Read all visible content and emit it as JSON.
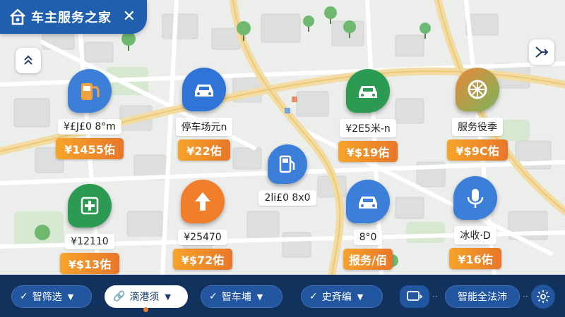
{
  "app": {
    "title": "车主服务之家",
    "close_glyph": "✕",
    "home_icon": "home-icon"
  },
  "controls": {
    "collapse_icon": "chevron-up-icon",
    "exit_icon": "exit-route-icon"
  },
  "pois": [
    {
      "id": "gas-station",
      "icon": "gas-station-icon",
      "color": "#3b7fd8",
      "label": "¥£J£0 8°m",
      "price": "¥1455佑"
    },
    {
      "id": "parking",
      "icon": "car-icon",
      "color": "#2f74d6",
      "label": "停车场元n",
      "price": "¥22佑"
    },
    {
      "id": "car-wash",
      "icon": "car-icon",
      "color": "#2c9a52",
      "label": "¥2E5米-n",
      "price": "¥$19佑"
    },
    {
      "id": "service-station",
      "icon": "compass-icon",
      "color": "#e8883a",
      "label": "服务役季",
      "price": "¥$9C佑"
    },
    {
      "id": "fuel-pump",
      "icon": "fuel-pump-icon",
      "color": "#3b7fd8",
      "label": "2li£0 8x0",
      "price": ""
    },
    {
      "id": "medical",
      "icon": "medical-cross-icon",
      "color": "#2c9a52",
      "label": "¥12110",
      "price": "¥$13佑"
    },
    {
      "id": "navigation",
      "icon": "arrow-up-icon",
      "color": "#f07e2b",
      "label": "¥25470",
      "price": "¥$72佑"
    },
    {
      "id": "repair",
      "icon": "car-icon",
      "color": "#3b7fd8",
      "label": "8°0",
      "price": "报务/佰"
    },
    {
      "id": "voice",
      "icon": "microphone-icon",
      "color": "#3b7fd8",
      "label": "冰收·D",
      "price": "¥16佑"
    }
  ],
  "bottom_bar": {
    "chips": [
      {
        "label": "智筛选",
        "icon": "check-icon",
        "active": false
      },
      {
        "label": "滴港须",
        "icon": "link-icon",
        "active": true
      },
      {
        "label": "智车埔",
        "icon": "check-icon",
        "active": false
      },
      {
        "label": "史斉编",
        "icon": "check-icon",
        "active": false
      }
    ],
    "screen_button_icon": "screen-cast-icon",
    "smart_button_label": "智能全法沛",
    "settings_icon": "gear-icon",
    "colors": {
      "bar": "#12325e",
      "chip": "#2256a0",
      "accent": "#f07e2b"
    }
  }
}
